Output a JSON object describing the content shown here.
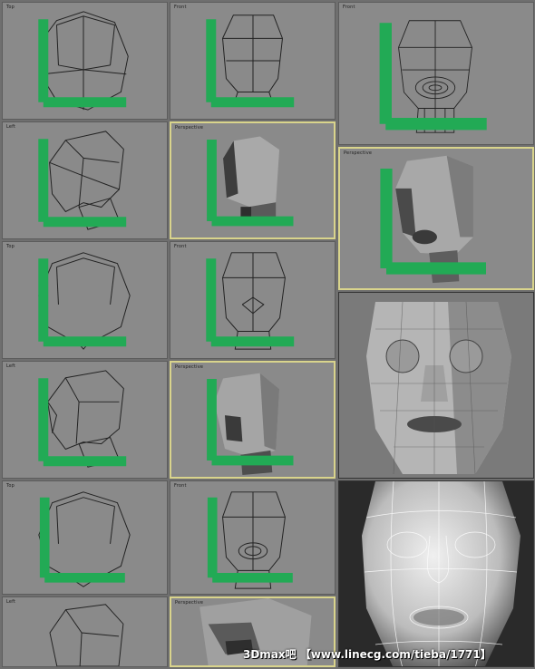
{
  "viewport_labels": {
    "top": "Top",
    "front": "Front",
    "left": "Left",
    "perspective": "Perspective"
  },
  "watermark": "3Dmax吧 【www.linecg.com/tieba/1771】",
  "colors": {
    "viewport_bg": "#8a8a8a",
    "active_border": "#d9d48c",
    "wire": "#222222"
  }
}
